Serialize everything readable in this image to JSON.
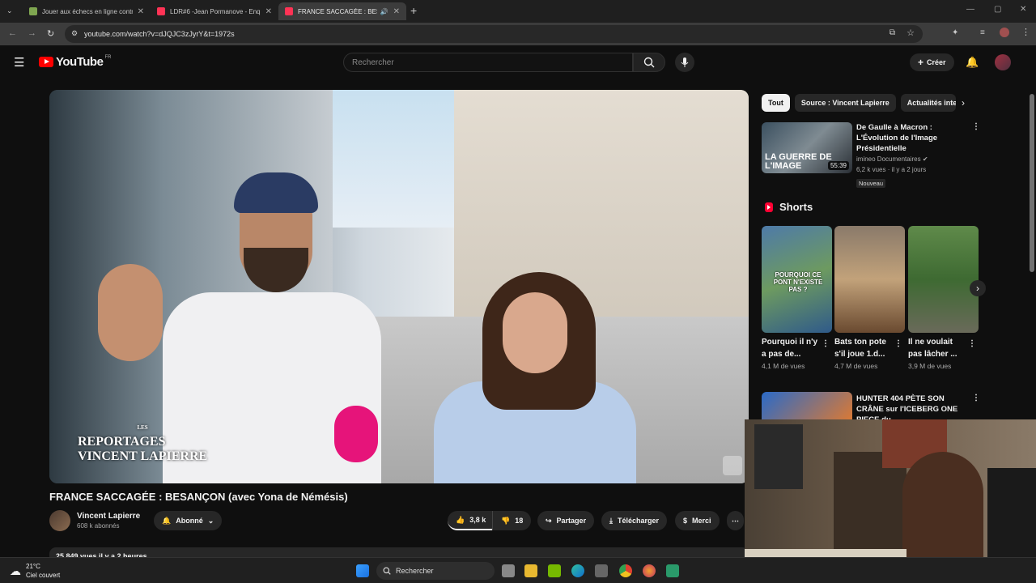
{
  "browser": {
    "tabs": [
      {
        "title": "Jouer aux échecs en ligne contr",
        "color": "#7fa650",
        "active": false
      },
      {
        "title": "LDR#6 -Jean Pormanove - Enqu",
        "color": "#ff3355",
        "active": false
      },
      {
        "title": "FRANCE SACCAGÉE : BESAN",
        "color": "#ff3355",
        "active": true
      }
    ],
    "url": "youtube.com/watch?v=dJQJC3zJyrY&t=1972s"
  },
  "youtube": {
    "logo_text": "YouTube",
    "region": "FR",
    "search_placeholder": "Rechercher",
    "create_label": "Créer"
  },
  "video": {
    "overlay_small": "LES",
    "overlay_line1": "REPORTAGES",
    "overlay_line2": "VINCENT LAPIERRE",
    "title": "FRANCE SACCAGÉE : BESANÇON (avec Yona de Némésis)",
    "channel": "Vincent Lapierre",
    "subscribers": "608 k abonnés",
    "subscribed_label": "Abonné",
    "likes": "3,8 k",
    "dislikes": "18",
    "share_label": "Partager",
    "download_label": "Télécharger",
    "thanks_label": "Merci",
    "description_partial": "25 849 vues  il y a 2 heures"
  },
  "sidebar": {
    "chips": [
      "Tout",
      "Source : Vincent Lapierre",
      "Actualités inte"
    ],
    "recommended": {
      "title": "De Gaulle à Macron : L'Évolution de l'Image Présidentielle",
      "channel": "imineo Documentaires",
      "meta": "6,2 k vues · il y a 2 jours",
      "badge": "Nouveau",
      "duration": "55:39",
      "thumb_caption": "LA GUERRE DE L'IMAGE"
    },
    "shorts_heading": "Shorts",
    "shorts": [
      {
        "title": "Pourquoi il n'y a pas de...",
        "views": "4,1 M de vues",
        "thumb_text": "POURQUOI CE PONT N'EXISTE PAS ?"
      },
      {
        "title": "Bats ton pote s'il joue 1.d...",
        "views": "4,7 M de vues",
        "thumb_text": ""
      },
      {
        "title": "Il ne voulait pas lâcher ...",
        "views": "3,9 M de vues",
        "thumb_text": ""
      }
    ],
    "recommended2": {
      "title": "HUNTER 404 PÈTE SON CRÂNE sur l'ICEBERG ONE PIECE du ..."
    }
  },
  "taskbar": {
    "temperature": "21°C",
    "weather": "Ciel couvert",
    "search_label": "Rechercher"
  }
}
